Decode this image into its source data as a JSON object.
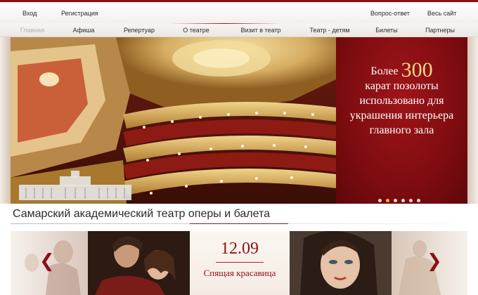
{
  "utility_nav": {
    "login": "Вход",
    "register": "Регистрация",
    "faq": "Вопрос-ответ",
    "sitemap": "Весь сайт"
  },
  "main_nav": [
    {
      "label": "Главная",
      "active": true
    },
    {
      "label": "Афиша"
    },
    {
      "label": "Репертуар"
    },
    {
      "label": "О театре"
    },
    {
      "label": "Визит в театр"
    },
    {
      "label": "Театр - детям"
    },
    {
      "label": "Билеты"
    },
    {
      "label": "Партнеры"
    }
  ],
  "hero": {
    "lead": "Более",
    "number": "300",
    "text": "карат позолоты использовано для украшения интерьера главного зала",
    "slides_total": 6,
    "slide_active": 2
  },
  "site_title": "Самарский академический театр оперы и балета",
  "carousel": {
    "event": {
      "date": "12.09",
      "title": "Спящая красавица"
    },
    "prev_icon": "chevron-left-icon",
    "next_icon": "chevron-right-icon"
  },
  "colors": {
    "brand": "#8c0f14",
    "gold": "#f3d88a",
    "dot_active": "#f0b13c"
  }
}
